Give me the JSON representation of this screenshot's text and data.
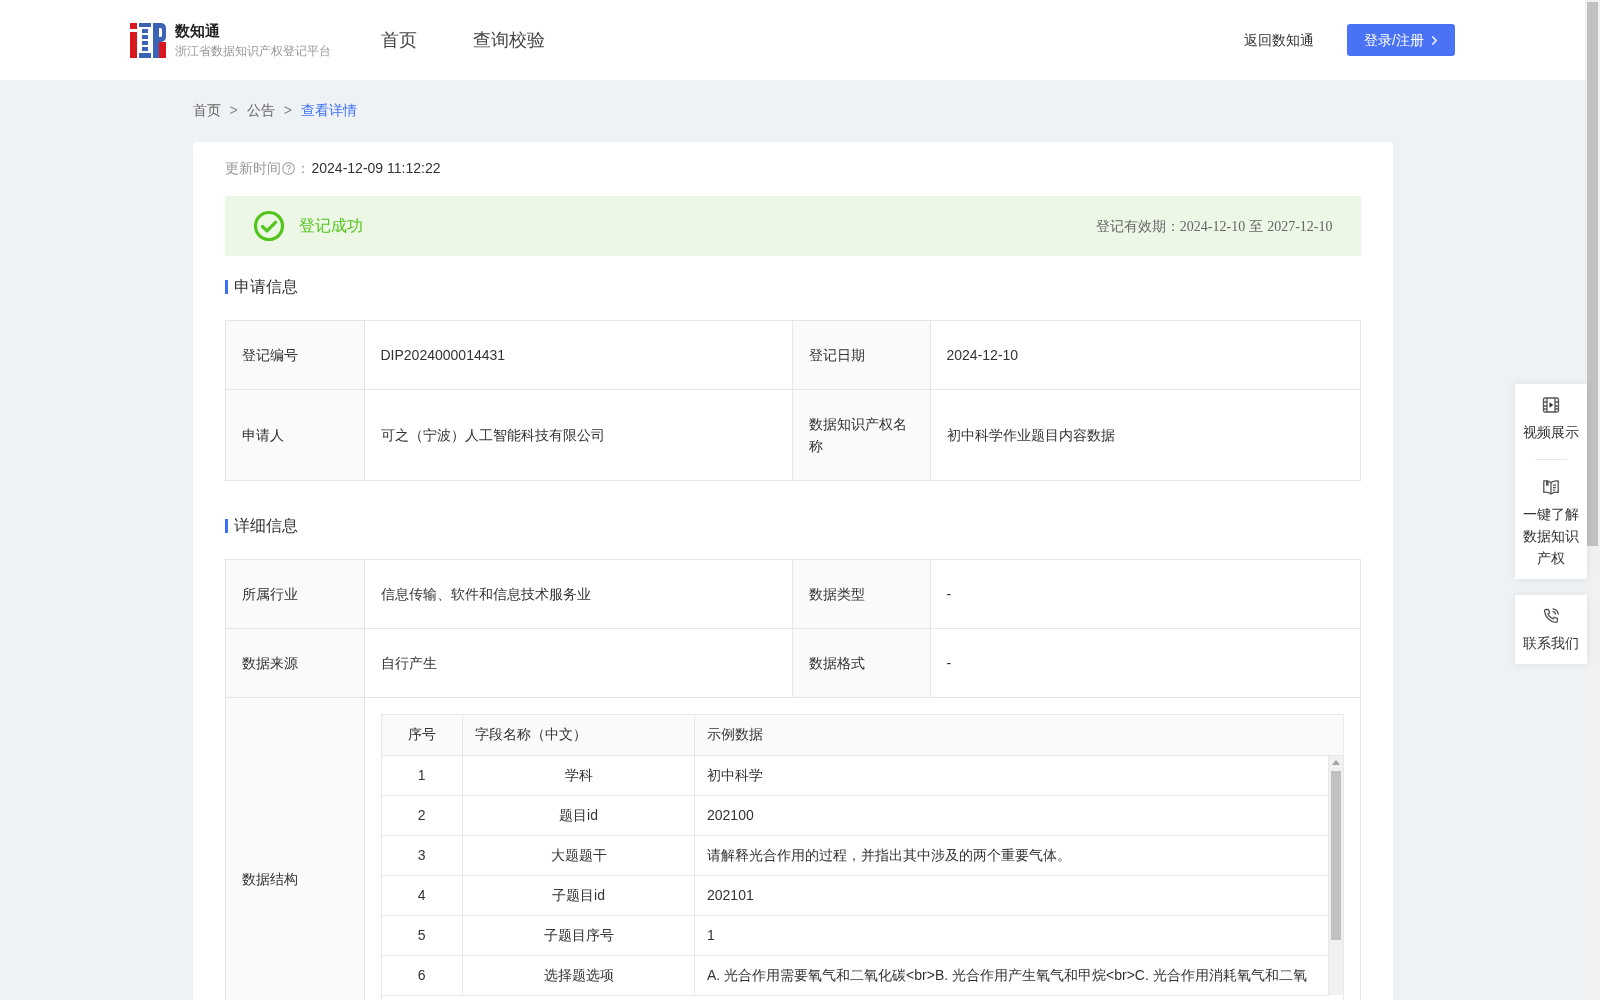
{
  "header": {
    "logo": {
      "title": "数知通",
      "subtitle": "浙江省数据知识产权登记平台"
    },
    "nav": [
      "首页",
      "查询校验"
    ],
    "back_link": "返回数知通",
    "login_button": "登录/注册"
  },
  "breadcrumb": [
    {
      "kind": "link",
      "text": "首页"
    },
    {
      "kind": "separator",
      "text": ">"
    },
    {
      "kind": "link",
      "text": "公告"
    },
    {
      "kind": "separator",
      "text": ">"
    },
    {
      "kind": "current",
      "text": "查看详情"
    }
  ],
  "update_time": {
    "label": "更新时间",
    "colon": "：",
    "value": "2024-12-09 11:12:22"
  },
  "status": {
    "kind": "success",
    "text": "登记成功",
    "validity": {
      "label": "登记有效期：",
      "from": "2024-12-10",
      "joiner": "至",
      "to": "2027-12-10"
    }
  },
  "sections": [
    {
      "title": "申请信息",
      "rows": [
        {
          "kind": "pairs",
          "cells": [
            {
              "label": "登记编号",
              "value": "DIP2024000014431"
            },
            {
              "label": "登记日期",
              "value": "2024-12-10"
            }
          ]
        },
        {
          "kind": "pairs",
          "cells": [
            {
              "label": "申请人",
              "value": "可之（宁波）人工智能科技有限公司"
            },
            {
              "label": "数据知识产权名称",
              "value": "初中科学作业题目内容数据"
            }
          ]
        }
      ]
    },
    {
      "title": "详细信息",
      "rows": [
        {
          "kind": "pairs",
          "cells": [
            {
              "label": "所属行业",
              "value": "信息传输、软件和信息技术服务业"
            },
            {
              "label": "数据类型",
              "value": "-"
            }
          ]
        },
        {
          "kind": "pairs",
          "cells": [
            {
              "label": "数据来源",
              "value": "自行产生"
            },
            {
              "label": "数据格式",
              "value": "-"
            }
          ]
        },
        {
          "kind": "table",
          "label": "数据结构",
          "table": {
            "columns": [
              "序号",
              "字段名称（中文）",
              "示例数据"
            ],
            "rows": [
              [
                "1",
                "学科",
                "初中科学"
              ],
              [
                "2",
                "题目id",
                "202100"
              ],
              [
                "3",
                "大题题干",
                "请解释光合作用的过程，并指出其中涉及的两个重要气体。"
              ],
              [
                "4",
                "子题目id",
                "202101"
              ],
              [
                "5",
                "子题目序号",
                "1"
              ],
              [
                "6",
                "选择题选项",
                "A. 光合作用需要氧气和二氧化碳<br>B. 光合作用产生氧气和甲烷<br>C. 光合作用消耗氧气和二氧"
              ]
            ]
          }
        }
      ]
    }
  ],
  "side_panel": [
    {
      "items": [
        {
          "kind": "video",
          "label": "视频展示"
        },
        {
          "kind": "book",
          "label": "一键了解数据知识产权"
        }
      ]
    },
    {
      "items": [
        {
          "kind": "phone",
          "label": "联系我们"
        }
      ]
    }
  ]
}
